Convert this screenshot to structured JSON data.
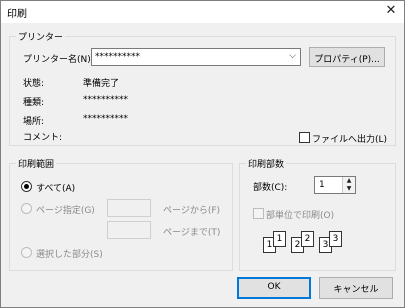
{
  "dialog": {
    "title": "印刷",
    "close_glyph": "✕"
  },
  "printer": {
    "group_label": "プリンター",
    "name_label": "プリンター名(N):",
    "selected_name": "**********",
    "properties_button": "プロパティ(P)...",
    "status_label": "状態:",
    "status_value": "準備完了",
    "type_label": "種類:",
    "type_value": "**********",
    "location_label": "場所:",
    "location_value": "**********",
    "comment_label": "コメント:",
    "print_to_file_label": "ファイルへ出力(L)"
  },
  "range": {
    "group_label": "印刷範囲",
    "all_label": "すべて(A)",
    "pages_label": "ページ指定(G)",
    "from_label": "ページから(F)",
    "to_label": "ページまで(T)",
    "selection_label": "選択した部分(S)"
  },
  "copies": {
    "group_label": "印刷部数",
    "count_label": "部数(C):",
    "count_value": "1",
    "collate_label": "部単位で印刷(O)",
    "collate_pages": [
      "1",
      "1",
      "2",
      "2",
      "3",
      "3"
    ]
  },
  "buttons": {
    "ok": "OK",
    "cancel": "キャンセル"
  }
}
